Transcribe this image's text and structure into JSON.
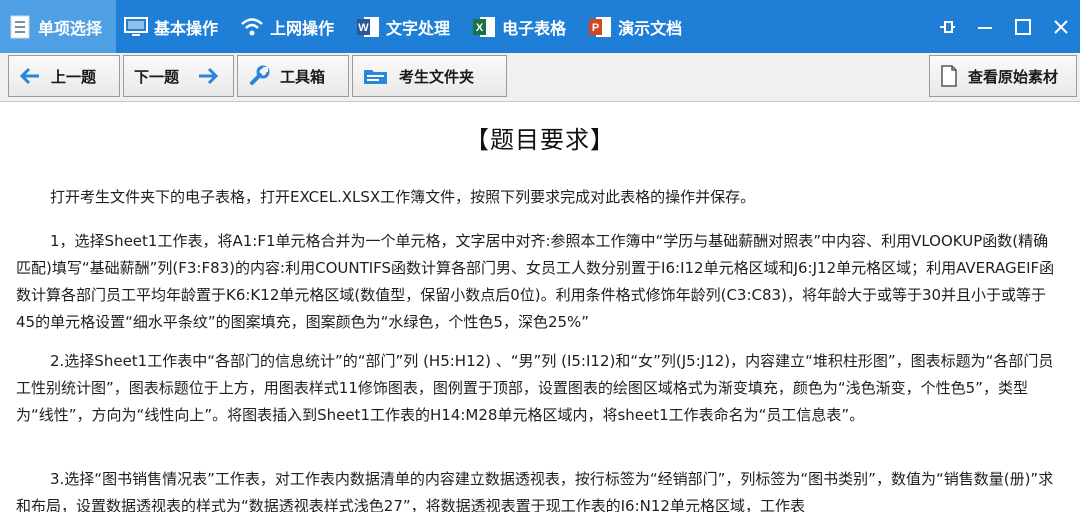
{
  "tabs": [
    {
      "label": "单项选择",
      "icon": "document-list-icon",
      "active": true
    },
    {
      "label": "基本操作",
      "icon": "monitor-icon",
      "active": false
    },
    {
      "label": "上网操作",
      "icon": "wifi-icon",
      "active": false
    },
    {
      "label": "文字处理",
      "icon": "word-icon",
      "active": false
    },
    {
      "label": "电子表格",
      "icon": "excel-icon",
      "active": false
    },
    {
      "label": "演示文档",
      "icon": "powerpoint-icon",
      "active": false
    }
  ],
  "window_controls": [
    "pin-icon",
    "minimize-icon",
    "maximize-icon",
    "close-icon"
  ],
  "toolbar": {
    "prev_label": "上一题",
    "next_label": "下一题",
    "toolbox_label": "工具箱",
    "folder_label": "考生文件夹",
    "view_label": "查看原始素材"
  },
  "colors": {
    "accent": "#1f7fd6",
    "active_tab": "#4e9fe3",
    "toolbar_bg": "#f0f0f0"
  },
  "content": {
    "title": "【题目要求】",
    "intro": "打开考生文件夹下的电子表格，打开EXCEL.XLSX工作簿文件，按照下列要求完成对此表格的操作并保存。",
    "item1": "1，选择Sheet1工作表，将A1:F1单元格合并为一个单元格，文字居中对齐:参照本工作簿中“学历与基础薪酬对照表”中内容、利用VLOOKUP函数(精确匹配)填写“基础薪酬”列(F3:F83)的内容:利用COUNTIFS函数计算各部门男、女员工人数分别置于I6:I12单元格区域和J6:J12单元格区域；利用AVERAGEIF函数计算各部门员工平均年龄置于K6:K12单元格区域(数值型，保留小数点后0位)。利用条件格式修饰年龄列(C3:C83)，将年龄大于或等于30并且小于或等于45的单元格设置“细水平条纹”的图案填充，图案颜色为“水绿色，个性色5，深色25%”",
    "item2": "2.选择Sheet1工作表中“各部门的信息统计”的“部门”列 (H5:H12) 、“男”列 (I5:I12)和“女”列(J5:J12)，内容建立“堆积柱形图”，图表标题为“各部门员工性别统计图”，图表标题位于上方，用图表样式11修饰图表，图例置于顶部，设置图表的绘图区域格式为渐变填充，颜色为“浅色渐变，个性色5”，类型为“线性”，方向为“线性向上”。将图表插入到Sheet1工作表的H14:M28单元格区域内，将sheet1工作表命名为“员工信息表”。",
    "item3": "3.选择“图书销售情况表”工作表，对工作表内数据清单的内容建立数据透视表，按行标签为“经销部门”，列标签为“图书类别”，数值为“销售数量(册)”求和布局，设置数据透视表的样式为“数据透视表样式浅色27”，将数据透视表置于现工作表的I6:N12单元格区域，工作表"
  }
}
